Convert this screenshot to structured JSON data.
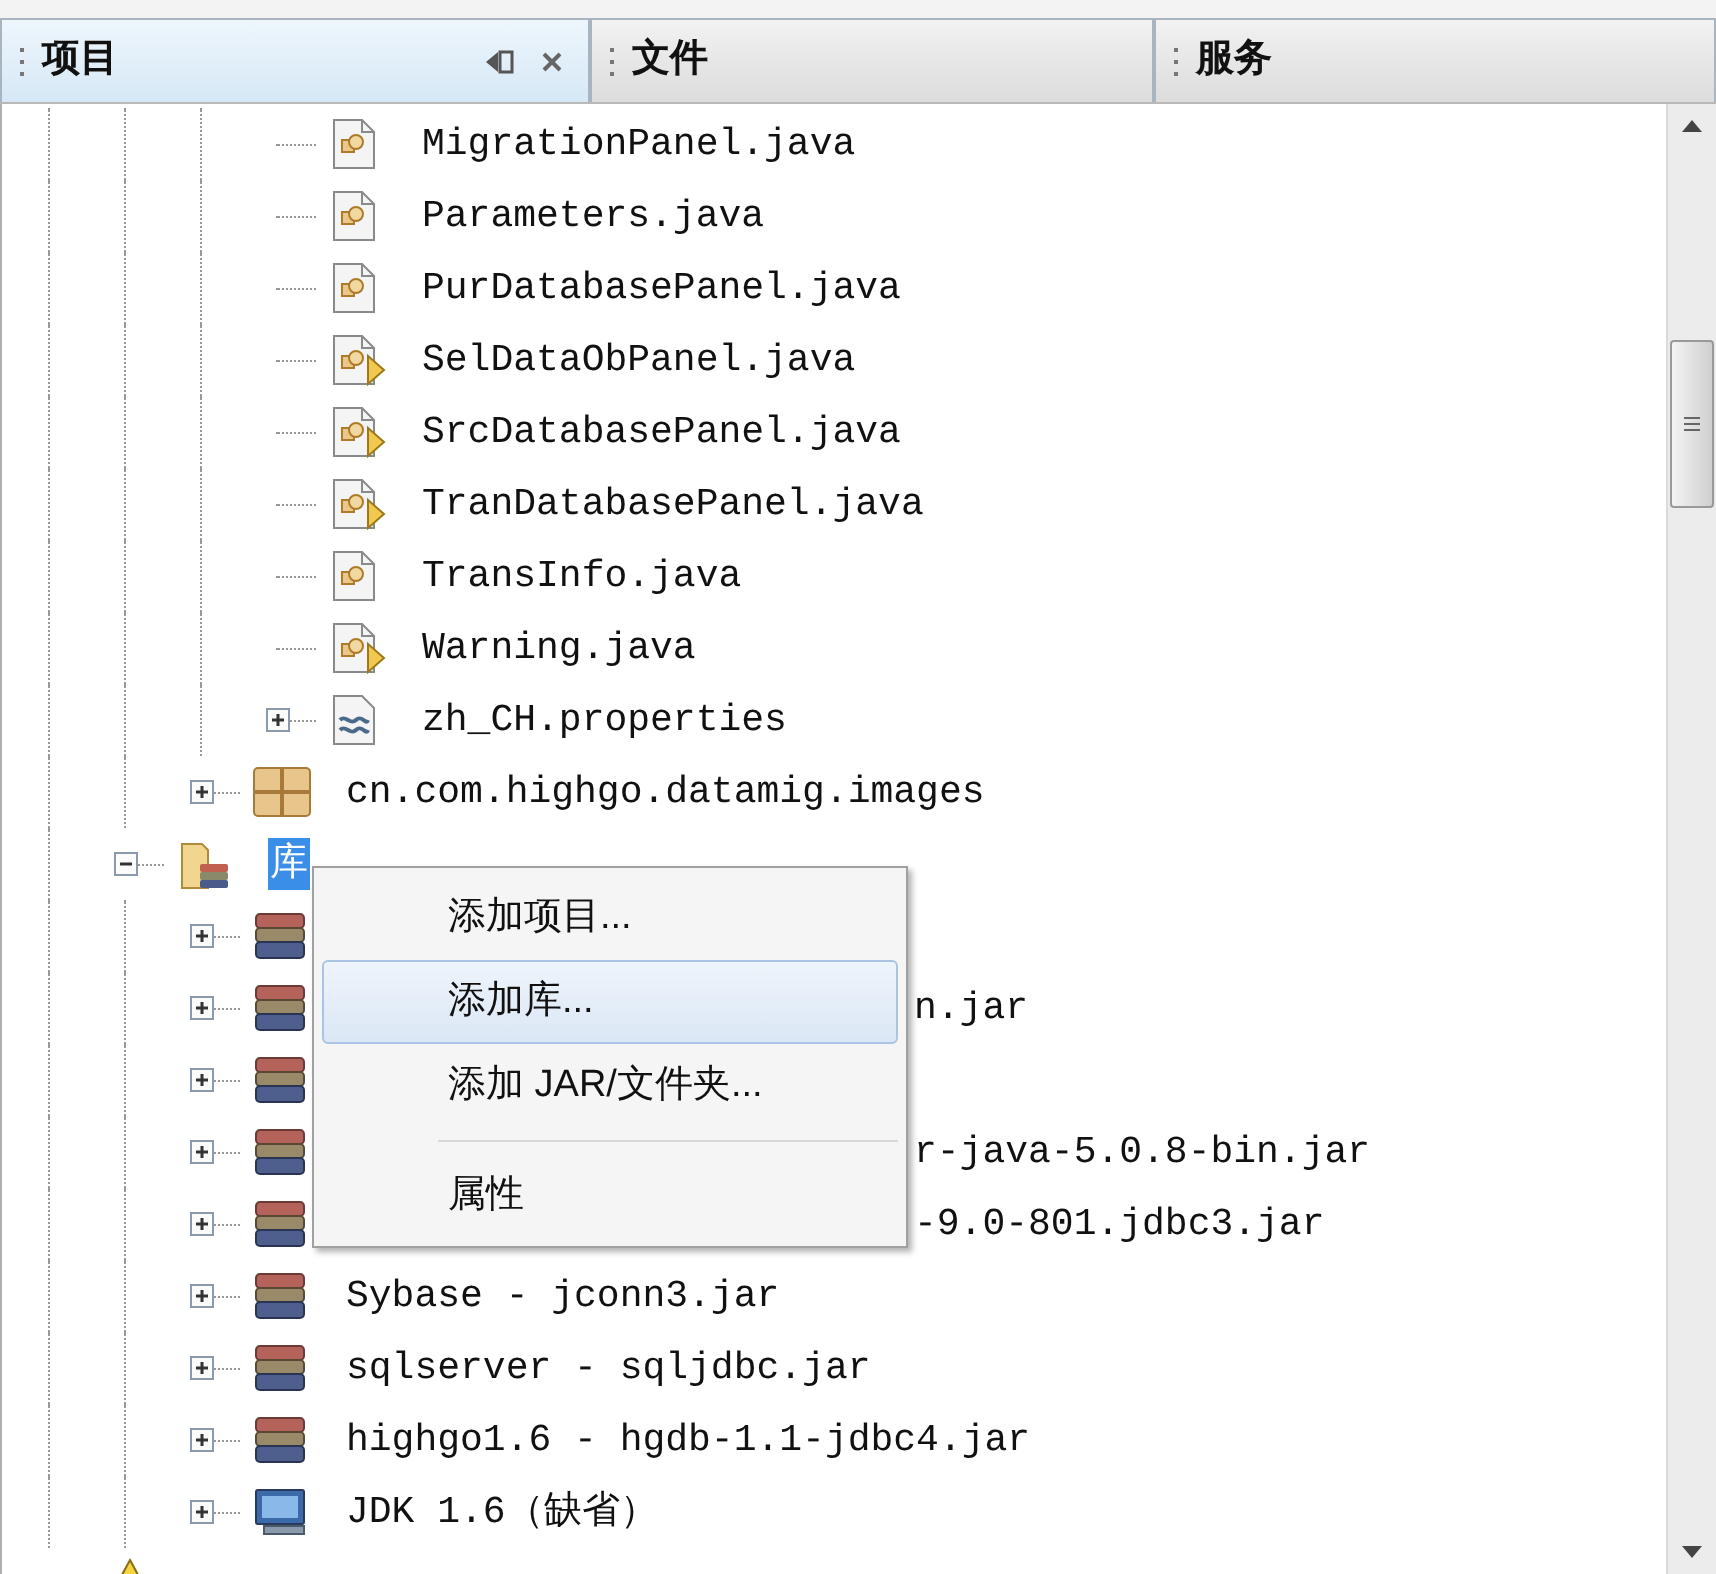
{
  "tabs": [
    {
      "label": "项目",
      "selected": true
    },
    {
      "label": "文件",
      "selected": false
    },
    {
      "label": "服务",
      "selected": false
    }
  ],
  "tree": [
    {
      "children": [
        {
          "children": [
            {
              "children": [
                {
                  "kind": "java",
                  "label": "MigrationPanel.java",
                  "selected": false
                },
                {
                  "kind": "java",
                  "label": "Parameters.java",
                  "selected": false
                },
                {
                  "kind": "java",
                  "label": "PurDatabasePanel.java",
                  "selected": false
                },
                {
                  "kind": "java-main",
                  "label": "SelDataObPanel.java",
                  "selected": false
                },
                {
                  "kind": "java-main",
                  "label": "SrcDatabasePanel.java",
                  "selected": false
                },
                {
                  "kind": "java-main",
                  "label": "TranDatabasePanel.java",
                  "selected": false
                },
                {
                  "kind": "java",
                  "label": "TransInfo.java",
                  "selected": false
                },
                {
                  "kind": "java-main",
                  "label": "Warning.java",
                  "selected": false
                },
                {
                  "kind": "properties",
                  "label": "zh_CH.properties",
                  "expanded": false,
                  "selected": false
                }
              ]
            },
            {
              "kind": "package-images",
              "label": "cn.com.highgo.datamig.images",
              "expanded": false,
              "selected": false
            }
          ]
        },
        {
          "kind": "libraries",
          "label": "库",
          "expanded": true,
          "selected": true,
          "children": [
            {
              "kind": "jar",
              "expanded": false
            },
            {
              "kind": "jar",
              "label": "n.jar",
              "expanded": false,
              "selected": false
            },
            {
              "kind": "jar",
              "expanded": false
            },
            {
              "kind": "jar",
              "label": "r-java-5.0.8-bin.jar",
              "expanded": false,
              "selected": false
            },
            {
              "kind": "jar",
              "label": "-9.0-801.jdbc3.jar",
              "expanded": false,
              "selected": false
            },
            {
              "kind": "jar",
              "label": "Sybase - jconn3.jar",
              "expanded": false,
              "selected": false
            },
            {
              "kind": "jar",
              "label": "sqlserver - sqljdbc.jar",
              "expanded": false,
              "selected": false
            },
            {
              "kind": "jar",
              "label": "highgo1.6 - hgdb-1.1-jdbc4.jar",
              "expanded": false,
              "selected": false
            },
            {
              "kind": "jdk",
              "label": "JDK 1.6（缺省）",
              "expanded": false,
              "selected": false
            }
          ]
        }
      ]
    },
    {
      "kind": "project-warning"
    }
  ],
  "context_menu": {
    "items": [
      {
        "kind": "item",
        "label": "添加项目...",
        "selected": false
      },
      {
        "kind": "item",
        "label": "添加库...",
        "selected": true
      },
      {
        "kind": "item",
        "label": "添加 JAR/文件夹...",
        "selected": false
      },
      {
        "kind": "separator"
      },
      {
        "kind": "item",
        "label": "属性",
        "selected": false
      }
    ]
  }
}
